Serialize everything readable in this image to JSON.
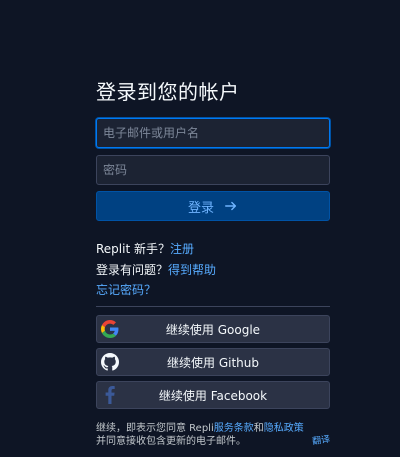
{
  "page": {
    "title": "登录到您的帐户"
  },
  "form": {
    "email_placeholder": "电子邮件或用户名",
    "password_placeholder": "密码",
    "login_label": "登录"
  },
  "links": {
    "new_prefix": "Replit 新手？",
    "signup": "注册",
    "help_prefix": "登录有问题？",
    "get_help": "得到帮助",
    "forgot_password": "忘记密码？"
  },
  "oauth": {
    "google": "继续使用 Google",
    "github": "继续使用 Github",
    "facebook": "继续使用 Facebook"
  },
  "terms": {
    "prefix": "继续，即表示您同意 Repli",
    "service_terms": "服务条款",
    "and": "和",
    "privacy_policy": "隐私政策",
    "suffix": "并同意接收包含更新的电子邮件。"
  },
  "overlay_text": "翻译",
  "colors": {
    "background": "#0e1525",
    "accent": "#0079f2",
    "link": "#57abff",
    "login_button": "#004182"
  }
}
